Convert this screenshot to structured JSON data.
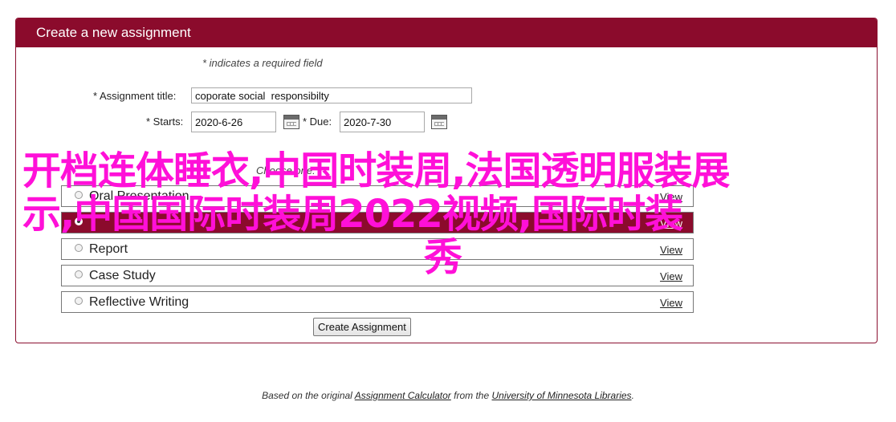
{
  "header": {
    "title": "Create a new assignment"
  },
  "form": {
    "required_note": "* indicates a required field",
    "title_label": "* Assignment title:",
    "title_value": "coporate social  responsibilty",
    "starts_label": "* Starts:",
    "starts_value": "2020-6-26",
    "due_label": "* Due:",
    "due_value": "2020-7-30",
    "choose_label": "Choose one:",
    "options": [
      {
        "label": "Oral Presentation",
        "view": "View",
        "selected": false
      },
      {
        "label": "",
        "view": "View",
        "selected": true
      },
      {
        "label": "Report",
        "view": "View",
        "selected": false
      },
      {
        "label": "Case Study",
        "view": "View",
        "selected": false
      },
      {
        "label": "Reflective Writing",
        "view": "View",
        "selected": false
      }
    ],
    "submit_label": "Create Assignment"
  },
  "overlay": {
    "line1": "开档连体睡衣,中国时装周,法国透明服装展",
    "line2": "示,中国国际时装周2022视频,国际时装",
    "line3": "秀",
    "color": "#ff10d8"
  },
  "footer": {
    "prefix": "Based on the original ",
    "link1": "Assignment Calculator",
    "middle": " from the ",
    "link2": "University of Minnesota Libraries",
    "suffix": "."
  },
  "colors": {
    "accent": "#8b0b2c"
  }
}
